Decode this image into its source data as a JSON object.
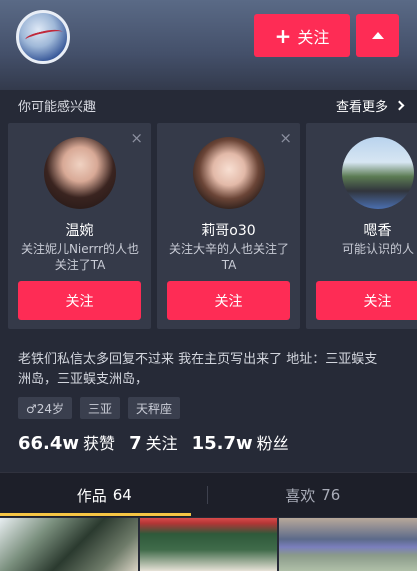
{
  "header": {
    "follow_plus": "+",
    "follow_label": "关注"
  },
  "suggestions": {
    "title": "你可能感兴趣",
    "see_more": "查看更多",
    "cards": [
      {
        "name": "温婉",
        "reason": "关注妮儿Nierrr的人也关注了TA",
        "follow": "关注",
        "close": "×"
      },
      {
        "name": "莉哥o30",
        "reason": "关注大辛的人也关注了TA",
        "follow": "关注",
        "close": "×"
      },
      {
        "name": "嗯香",
        "reason": "可能认识的人",
        "follow": "关注",
        "close": "×"
      }
    ]
  },
  "bio": {
    "text": "老铁们私信太多回复不过来 我在主页写出来了 地址：三亚蜈支洲岛，三亚蜈支洲岛，"
  },
  "tags": [
    "♂24岁",
    "三亚",
    "天秤座"
  ],
  "stats": {
    "likes_num": "66.4w",
    "likes_label": "获赞",
    "following_num": "7",
    "following_label": "关注",
    "fans_num": "15.7w",
    "fans_label": "粉丝"
  },
  "tabs": {
    "works_label": "作品",
    "works_count": "64",
    "likes_label": "喜欢",
    "likes_count": "76"
  },
  "colors": {
    "accent": "#fe2c55",
    "tab_indicator": "#f6c544",
    "background": "#262a37"
  }
}
